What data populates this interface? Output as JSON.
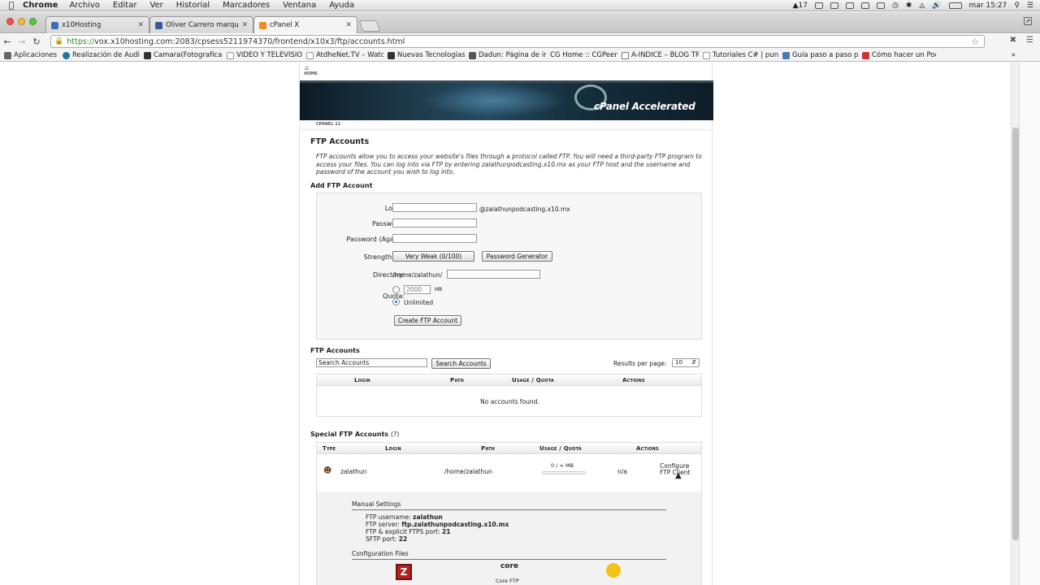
{
  "menubar": {
    "app": "Chrome",
    "items": [
      "Archivo",
      "Editar",
      "Ver",
      "Historial",
      "Marcadores",
      "Ventana",
      "Ayuda"
    ],
    "status": {
      "notif_count": "17",
      "clock": "mar 15:27"
    }
  },
  "tabs": [
    {
      "title": "x10Hosting",
      "color": "#3d6fb5"
    },
    {
      "title": "Oliver Carrero marquez - C",
      "color": "#3b5998"
    },
    {
      "title": "cPanel X",
      "color": "#f08a24"
    }
  ],
  "toolbar": {
    "url_https": "https://",
    "url_rest": "vox.x10hosting.com:2083/cpsess5211974370/frontend/x10x3/ftp/accounts.html"
  },
  "bookmarks": [
    {
      "label": "Aplicaciones",
      "color": "#666"
    },
    {
      "label": "Realización de Audi",
      "color": "#21759b"
    },
    {
      "label": "Camara(Fotografica",
      "color": "#333"
    },
    {
      "label": "VIDEO Y TELEVISION",
      "color": "#999"
    },
    {
      "label": "AtdheNet.TV – Watc",
      "color": "#999"
    },
    {
      "label": "Nuevas Tecnologías",
      "color": "#333"
    },
    {
      "label": "Dadun: Página de in",
      "color": "#555"
    },
    {
      "label": "CG Home :: CGPeers",
      "color": "#c33"
    },
    {
      "label": "A-INDICE – BLOG TR",
      "color": "#777"
    },
    {
      "label": "Tutoriales C# | punt",
      "color": "#999"
    },
    {
      "label": "Guía paso a paso pa",
      "color": "#4a7ab0"
    },
    {
      "label": "Cómo hacer un Podc",
      "color": "#c33"
    }
  ],
  "cpanel": {
    "home_label": "HOME",
    "version_label": "CPANEL 11",
    "logo_text": "cPanel Accelerated",
    "page_title": "FTP Accounts",
    "description": "FTP accounts allow you to access your website's files through a protocol called FTP. You will need a third-party FTP program to access your files. You can log into via FTP by entering zalathunpodcasting.x10.mx as your FTP host and the username and password of the account you wish to log into.",
    "add": {
      "heading": "Add FTP Account",
      "login_label": "Login:",
      "login_value": "",
      "domain_suffix": "@zalathunpodcasting.x10.mx",
      "password_label": "Password:",
      "password_again_label": "Password (Again):",
      "strength_label": "Strength (?):",
      "strength_value": "Very Weak (0/100)",
      "generator_btn": "Password Generator",
      "directory_label": "Directory:",
      "directory_prefix": "/home/zalathun/",
      "directory_value": "",
      "quota_label": "Quota:",
      "quota_value": "2000",
      "quota_unit": "MB",
      "unlimited_label": "Unlimited",
      "create_btn": "Create FTP Account"
    },
    "accounts": {
      "heading": "FTP Accounts",
      "search_placeholder": "Search Accounts",
      "search_btn": "Search Accounts",
      "rpp_label": "Results per page:",
      "rpp_value": "10",
      "columns": [
        "Login",
        "Path",
        "Usage / Quota",
        "Actions"
      ],
      "empty": "No accounts found."
    },
    "special": {
      "heading": "Special FTP Accounts",
      "help": "(?)",
      "columns": [
        "Type",
        "Login",
        "Path",
        "Usage / Quota",
        "Actions"
      ],
      "row": {
        "login": "zalathun",
        "path": "/home/zalathun",
        "usage": "0 / ∞ MB",
        "usage_fraction": 0,
        "na": "n/a",
        "action_line1": "Configure",
        "action_line2": "FTP Client"
      },
      "manual": {
        "heading": "Manual Settings",
        "username_label": "FTP username:",
        "username": "zalathun",
        "server_label": "FTP server:",
        "server": "ftp.zalathunpodcasting.x10.mx",
        "port_label": "FTP & explicit FTPS port:",
        "port": "21",
        "sftp_label": "SFTP port:",
        "sftp": "22"
      },
      "config_heading": "Configuration Files",
      "config_items": [
        "Core FTP"
      ]
    }
  }
}
